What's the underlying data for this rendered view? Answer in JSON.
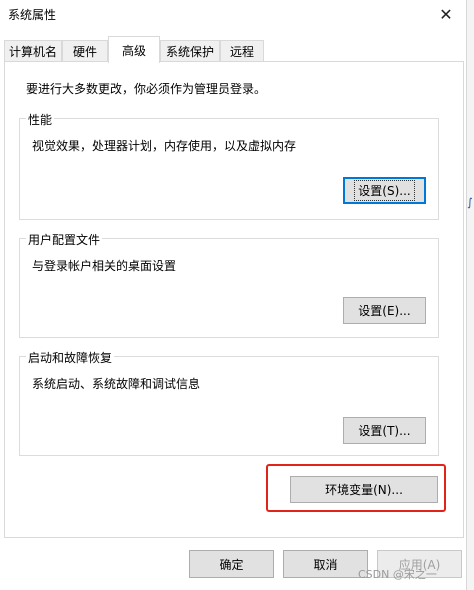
{
  "window": {
    "title": "系统属性",
    "close_glyph": "✕"
  },
  "tabs": [
    {
      "label": "计算机名"
    },
    {
      "label": "硬件"
    },
    {
      "label": "高级",
      "active": true
    },
    {
      "label": "系统保护"
    },
    {
      "label": "远程"
    }
  ],
  "notice": "要进行大多数更改，你必须作为管理员登录。",
  "groups": {
    "performance": {
      "title": "性能",
      "description": "视觉效果，处理器计划，内存使用，以及虚拟内存",
      "button": "设置(S)..."
    },
    "user_profiles": {
      "title": "用户配置文件",
      "description": "与登录帐户相关的桌面设置",
      "button": "设置(E)..."
    },
    "startup_recovery": {
      "title": "启动和故障恢复",
      "description": "系统启动、系统故障和调试信息",
      "button": "设置(T)..."
    }
  },
  "env_button": "环境变量(N)...",
  "footer": {
    "ok": "确定",
    "cancel": "取消",
    "apply": "应用(A)"
  },
  "watermark": "CSDN @宋之一",
  "edge_glyph": "∫",
  "colors": {
    "highlight": "#e2231a",
    "focus": "#0078d7"
  }
}
